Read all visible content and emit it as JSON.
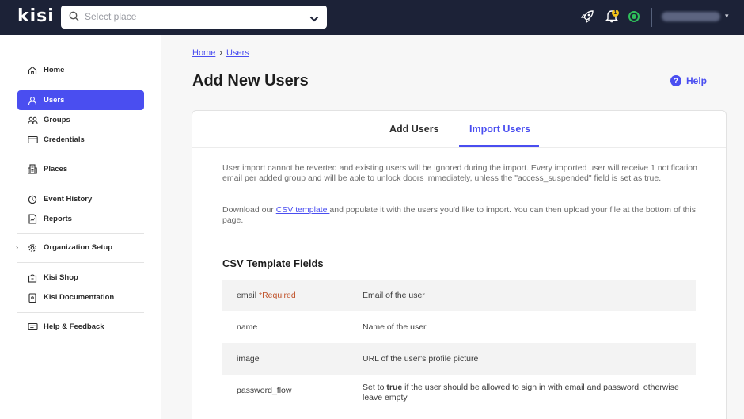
{
  "topbar": {
    "logo": "kisi",
    "place_placeholder": "Select place",
    "notification_count": "1",
    "icons": [
      "search-icon",
      "chevron-down-icon",
      "rocket-icon",
      "bell-icon",
      "status-icon"
    ]
  },
  "sidebar": {
    "items": [
      {
        "label": "Home",
        "icon": "home-icon"
      },
      {
        "label": "Users",
        "icon": "user-icon",
        "active": true
      },
      {
        "label": "Groups",
        "icon": "groups-icon"
      },
      {
        "label": "Credentials",
        "icon": "card-icon"
      },
      {
        "label": "Places",
        "icon": "building-icon"
      },
      {
        "label": "Event History",
        "icon": "history-icon"
      },
      {
        "label": "Reports",
        "icon": "report-icon"
      },
      {
        "label": "Organization Setup",
        "icon": "gear-icon"
      },
      {
        "label": "Kisi Shop",
        "icon": "shop-icon"
      },
      {
        "label": "Kisi Documentation",
        "icon": "document-icon"
      },
      {
        "label": "Help & Feedback",
        "icon": "feedback-icon"
      }
    ]
  },
  "breadcrumb": {
    "home": "Home",
    "separator": "›",
    "current": "Users"
  },
  "page": {
    "title": "Add New Users",
    "help_label": "Help",
    "help_icon": "?"
  },
  "tabs": [
    {
      "label": "Add Users",
      "active": false
    },
    {
      "label": "Import Users",
      "active": true
    }
  ],
  "import": {
    "intro": "User import cannot be reverted and existing users will be ignored during the import. Every imported user will receive 1 notification email per added group and will be able to unlock doors immediately, unless the \"access_suspended\" field is set as true.",
    "download_prefix": "Download our ",
    "download_link": "CSV template ",
    "download_suffix": "and populate it with the users you'd like to import. You can then upload your file at the bottom of this page.",
    "section_title": "CSV Template Fields",
    "fields": [
      {
        "name": "email",
        "required": "*Required",
        "description": "Email of the user"
      },
      {
        "name": "name",
        "required": "",
        "description": "Name of the user"
      },
      {
        "name": "image",
        "required": "",
        "description": "URL of the user's profile picture"
      },
      {
        "name": "password_flow",
        "required": "",
        "description_prefix": "Set to ",
        "description_bold": "true",
        "description_suffix": " if the user should be allowed to sign in with email and password, otherwise leave empty"
      }
    ]
  },
  "colors": {
    "accent": "#4a4ef0",
    "topbar": "#1c2237",
    "required": "#c0532b",
    "status": "#2fbf5b"
  }
}
